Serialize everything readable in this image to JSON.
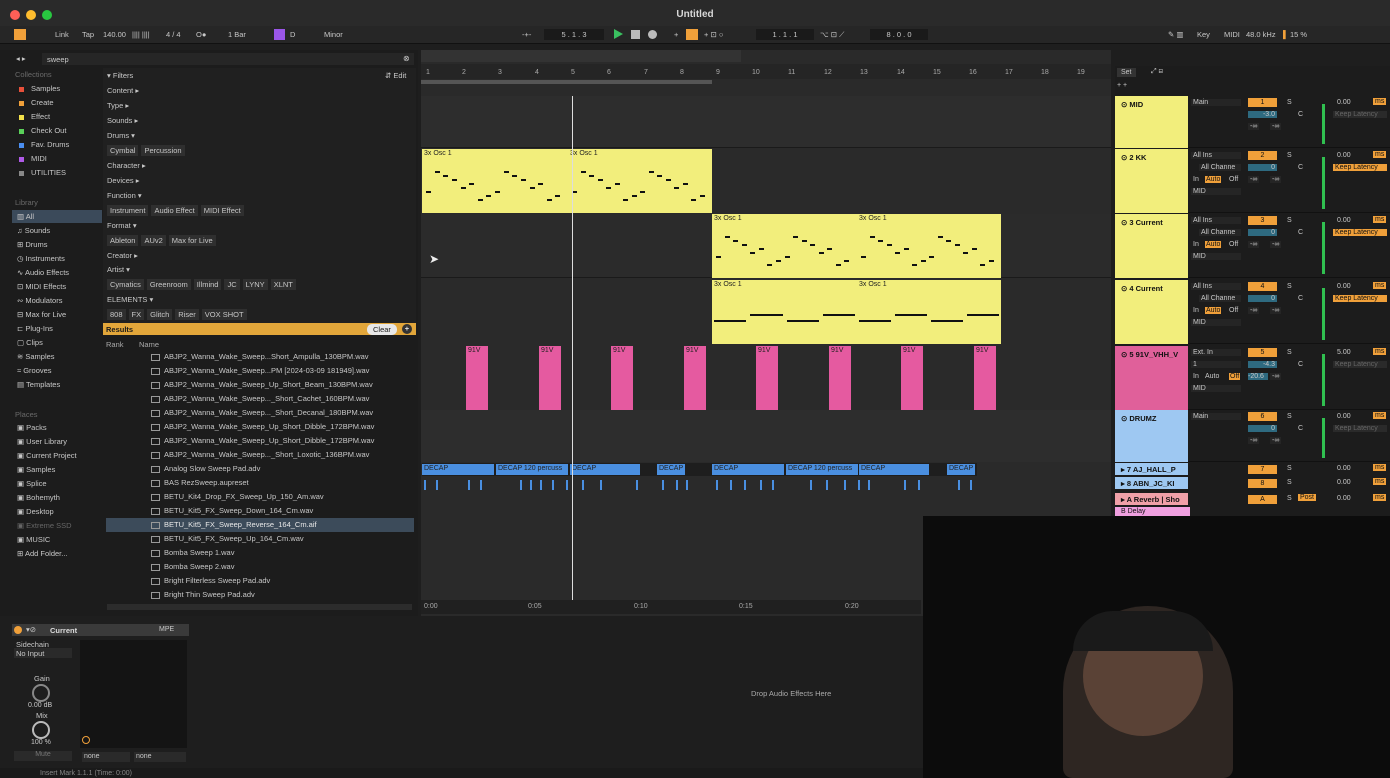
{
  "app": {
    "title": "Untitled"
  },
  "transport": {
    "link": "Link",
    "tap": "Tap",
    "tempo": "140.00",
    "sig": "4 / 4",
    "quant": "1 Bar",
    "key_root": "D",
    "key_scale": "Minor",
    "position": "5 . 1 . 3",
    "loop_start": "1 . 1 . 1",
    "loop_len": "8 . 0 . 0",
    "key_label": "Key",
    "midi_label": "MIDI",
    "sample_rate": "48.0 kHz",
    "cpu": "15 %"
  },
  "browser": {
    "search": "sweep",
    "collections_title": "Collections",
    "collections": [
      "Samples",
      "Create",
      "Effect",
      "Check Out",
      "Fav. Drums",
      "MIDI",
      "UTILITIES"
    ],
    "library_title": "Library",
    "library": [
      "All",
      "Sounds",
      "Drums",
      "Instruments",
      "Audio Effects",
      "MIDI Effects",
      "Modulators",
      "Max for Live",
      "Plug-Ins",
      "Clips",
      "Samples",
      "Grooves",
      "Templates"
    ],
    "places_title": "Places",
    "places": [
      "Packs",
      "User Library",
      "Current Project",
      "Samples",
      "Splice",
      "Bohemyth",
      "Desktop",
      "Extreme SSD",
      "MUSIC",
      "Add Folder..."
    ]
  },
  "filters": {
    "title": "Filters",
    "edit": "Edit",
    "rows": [
      {
        "label": "Content ▸",
        "tags": []
      },
      {
        "label": "Type ▸",
        "tags": []
      },
      {
        "label": "Sounds ▸",
        "tags": []
      },
      {
        "label": "Drums ▾",
        "tags": [
          "Cymbal",
          "Percussion"
        ]
      },
      {
        "label": "Character ▸",
        "tags": []
      },
      {
        "label": "Devices ▸",
        "tags": []
      },
      {
        "label": "Function ▾",
        "tags": [
          "Instrument",
          "Audio Effect",
          "MIDI Effect"
        ]
      },
      {
        "label": "Format ▾",
        "tags": [
          "Ableton",
          "AUv2",
          "Max for Live"
        ]
      },
      {
        "label": "Creator ▸",
        "tags": []
      },
      {
        "label": "Artist ▾",
        "tags": [
          "Cymatics",
          "Greenroom",
          "Illmind",
          "JC",
          "LYNY",
          "XLNT"
        ]
      },
      {
        "label": "ELEMENTS ▾",
        "tags": [
          "808",
          "FX",
          "Glitch",
          "Riser",
          "VOX SHOT"
        ]
      }
    ]
  },
  "results": {
    "title": "Results",
    "clear": "Clear",
    "col_rank": "Rank",
    "col_name": "Name",
    "files": [
      "ABJP2_Wanna_Wake_Sweep...Short_Ampulla_130BPM.wav",
      "ABJP2_Wanna_Wake_Sweep...PM [2024-03-09 181949].wav",
      "ABJP2_Wanna_Wake_Sweep_Up_Short_Beam_130BPM.wav",
      "ABJP2_Wanna_Wake_Sweep..._Short_Cachet_160BPM.wav",
      "ABJP2_Wanna_Wake_Sweep..._Short_Decanal_180BPM.wav",
      "ABJP2_Wanna_Wake_Sweep_Up_Short_Dibble_172BPM.wav",
      "ABJP2_Wanna_Wake_Sweep_Up_Short_Dibble_172BPM.wav",
      "ABJP2_Wanna_Wake_Sweep..._Short_Loxotic_136BPM.wav",
      "Analog Slow Sweep Pad.adv",
      "BAS RezSweep.aupreset",
      "BETU_Kit4_Drop_FX_Sweep_Up_150_Am.wav",
      "BETU_Kit5_FX_Sweep_Down_164_Cm.wav",
      "BETU_Kit5_FX_Sweep_Reverse_164_Cm.aif",
      "BETU_Kit5_FX_Sweep_Up_164_Cm.wav",
      "Bomba Sweep 1.wav",
      "Bomba Sweep 2.wav",
      "Bright Filterless Sweep Pad.adv",
      "Bright Thin Sweep Pad.adv"
    ]
  },
  "arrangement": {
    "bars": [
      "1",
      "2",
      "3",
      "4",
      "5",
      "6",
      "7",
      "8",
      "9",
      "10",
      "11",
      "12",
      "13",
      "14",
      "15",
      "16",
      "17",
      "18",
      "19"
    ],
    "times": [
      "0:00",
      "0:05",
      "0:10",
      "0:15",
      "0:20"
    ],
    "set": "Set",
    "clip_osc": "3x Osc 1",
    "clip_91v": "91V",
    "clip_decap": "DECAP",
    "clip_decap2": "DECAP 120 percuss"
  },
  "mixer": {
    "tracks": [
      {
        "name": "MID",
        "color": "#f2ee7c",
        "input": "Main",
        "num": "1",
        "vol": "-3.0",
        "send": "0.00",
        "lat": "Keep Latency"
      },
      {
        "name": "2 KK",
        "color": "#f2ee7c",
        "input": "All Ins",
        "num": "2",
        "vol": "0",
        "send": "0.00",
        "lat": "Keep Latency"
      },
      {
        "name": "3 Current",
        "color": "#f2ee7c",
        "input": "All Ins",
        "num": "3",
        "vol": "0",
        "send": "0.00",
        "lat": "Keep Latency"
      },
      {
        "name": "4 Current",
        "color": "#f2ee7c",
        "input": "All Ins",
        "num": "4",
        "vol": "0",
        "send": "0.00",
        "lat": "Keep Latency"
      },
      {
        "name": "5 91V_VHH_V",
        "color": "#e0609a",
        "input": "Ext. In",
        "num": "5",
        "vol": "-4.3",
        "send": "5.00",
        "lat": "Keep Latency"
      },
      {
        "name": "DRUMZ",
        "color": "#9ec8f2",
        "input": "Main",
        "num": "6",
        "vol": "0",
        "send": "0.00",
        "lat": "Keep Latency"
      }
    ],
    "chan": "All Channe",
    "in": "In",
    "auto": "Auto",
    "off": "Off",
    "midi": "MID",
    "c": "C",
    "inf": "-∞",
    "ext_ch": "1",
    "ext_val": "-20.6",
    "r7": "7 AJ_HALL_P",
    "r8": "8 ABN_JC_KI",
    "ra": "A Reverb | Sho",
    "rb": "B Delay",
    "post": "Post",
    "ms": "ms",
    "S": "S"
  },
  "device": {
    "name": "Current",
    "mpe": "MPE",
    "sidechain": "Sidechain",
    "no_input": "No Input",
    "gain": "Gain",
    "gain_val": "0.00 dB",
    "mix": "Mix",
    "mix_val": "100 %",
    "mute": "Mute",
    "none": "none",
    "drop": "Drop Audio Effects Here"
  },
  "status": {
    "text": "Insert Mark 1.1.1 (Time: 0:00)"
  }
}
